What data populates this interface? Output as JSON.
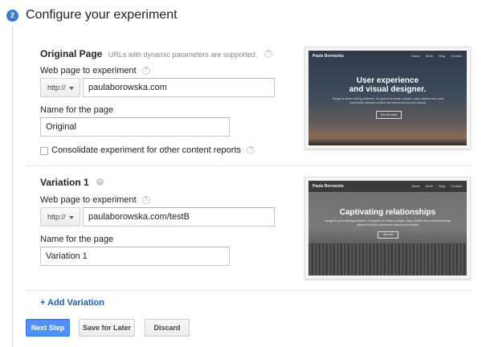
{
  "step": {
    "number": "2",
    "title": "Configure your experiment"
  },
  "original": {
    "heading": "Original Page",
    "note": "URLs with dynamic parameters are supported.",
    "web_label": "Web page to experiment",
    "protocol": "http://",
    "url": "paulaborowska.com",
    "name_label": "Name for the page",
    "name_value": "Original",
    "consolidate_label": "Consolidate experiment for other content reports",
    "preview": {
      "site_name": "Paula Borowska",
      "nav": [
        "About",
        "Work",
        "Blog",
        "Contact"
      ],
      "headline_1": "User experience",
      "headline_2": "and visual designer.",
      "body": "Design is about solving problems. The goal is to create a simple, easy, intuitive and, most importantly, pleasant solution that seems obvious and natural.",
      "cta": "See the work"
    }
  },
  "variation": {
    "heading": "Variation 1",
    "web_label": "Web page to experiment",
    "protocol": "http://",
    "url": "paulaborowska.com/testB",
    "name_label": "Name for the page",
    "name_value": "Variation 1",
    "preview": {
      "site_name": "Paula Borowska",
      "nav": [
        "About",
        "Work",
        "Blog",
        "Contact"
      ],
      "headline": "Captivating relationships",
      "body": "Design is about solving problems. The goal is to create a simple, easy, intuitive and, most importantly, pleasant solution that seems obvious and natural.",
      "cta": "Hire me"
    }
  },
  "add_variation": "+ Add Variation",
  "buttons": {
    "next": "Next Step",
    "save": "Save for Later",
    "discard": "Discard"
  },
  "help_glyph": "?",
  "remove_glyph": "×",
  "colors": {
    "accent": "#3b7bd4",
    "primary_button": "#4d90fe",
    "link": "#1a5fb4"
  }
}
